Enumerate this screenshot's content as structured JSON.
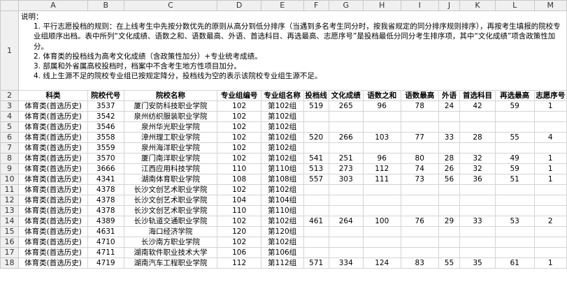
{
  "columns": [
    "A",
    "B",
    "C",
    "D",
    "E",
    "F",
    "G",
    "H",
    "I",
    "J",
    "K",
    "L",
    "M"
  ],
  "row_numbers": [
    "1",
    "2"
  ],
  "notes": {
    "title": "说明：",
    "lines": [
      "1. 平行志愿投档的规则：在上线考生中先按分数优先的原则从高分到低分排序（当遇到多名考生同分时，按我省规定的同分排序规则排序），再按考生填报的院校专业组顺序出档。表中所列“文化成绩、语数之和、语数最高、外语、首选科目、再选最高、志愿序号”是投档最低分同分考生排序项，其中“文化成绩”项含政策性加分。",
      "2. 体育类的投档线为高考文化成绩（含政策性加分）+专业统考成绩。",
      "3. 部属和外省属高校投档时，档案中不含考生地方性项目加分。",
      "4. 线上生源不足的院校专业组已按规定降分，投档线为空的表示该院校专业组生源不足。"
    ]
  },
  "table": {
    "headers": [
      "科类",
      "院校代号",
      "院校名称",
      "专业组编号",
      "专业组名称",
      "投档线",
      "文化成绩",
      "语数之和",
      "语数最高",
      "外语",
      "首选科目",
      "再选最高",
      "志愿序号"
    ],
    "rows": [
      {
        "num": "3",
        "cells": [
          "体育类(首选历史)",
          "3537",
          "厦门安防科技职业学院",
          "102",
          "第102组",
          "519",
          "265",
          "96",
          "78",
          "24",
          "42",
          "59",
          "1"
        ]
      },
      {
        "num": "4",
        "cells": [
          "体育类(首选历史)",
          "3542",
          "泉州纺织服装职业学院",
          "102",
          "第102组",
          "",
          "",
          "",
          "",
          "",
          "",
          "",
          ""
        ]
      },
      {
        "num": "5",
        "cells": [
          "体育类(首选历史)",
          "3546",
          "泉州华光职业学院",
          "102",
          "第102组",
          "",
          "",
          "",
          "",
          "",
          "",
          "",
          ""
        ]
      },
      {
        "num": "6",
        "cells": [
          "体育类(首选历史)",
          "3558",
          "漳州理工职业学院",
          "102",
          "第102组",
          "520",
          "266",
          "103",
          "77",
          "33",
          "28",
          "55",
          "4"
        ]
      },
      {
        "num": "7",
        "cells": [
          "体育类(首选历史)",
          "3559",
          "泉州海洋职业学院",
          "102",
          "第102组",
          "",
          "",
          "",
          "",
          "",
          "",
          "",
          ""
        ]
      },
      {
        "num": "8",
        "cells": [
          "体育类(首选历史)",
          "3570",
          "厦门南洋职业学院",
          "102",
          "第102组",
          "541",
          "251",
          "96",
          "80",
          "28",
          "32",
          "49",
          "1"
        ]
      },
      {
        "num": "9",
        "cells": [
          "体育类(首选历史)",
          "3666",
          "江西应用科技学院",
          "110",
          "第110组",
          "513",
          "273",
          "112",
          "74",
          "26",
          "32",
          "59",
          "1"
        ]
      },
      {
        "num": "10",
        "cells": [
          "体育类(首选历史)",
          "4341",
          "湖南体育职业学院",
          "108",
          "第108组",
          "557",
          "303",
          "111",
          "73",
          "56",
          "36",
          "51",
          "1"
        ]
      },
      {
        "num": "11",
        "cells": [
          "体育类(首选历史)",
          "4378",
          "长沙文创艺术职业学院",
          "102",
          "第102组",
          "",
          "",
          "",
          "",
          "",
          "",
          "",
          ""
        ]
      },
      {
        "num": "12",
        "cells": [
          "体育类(首选历史)",
          "4378",
          "长沙文创艺术职业学院",
          "104",
          "第104组",
          "",
          "",
          "",
          "",
          "",
          "",
          "",
          ""
        ]
      },
      {
        "num": "13",
        "cells": [
          "体育类(首选历史)",
          "4378",
          "长沙文创艺术职业学院",
          "110",
          "第110组",
          "",
          "",
          "",
          "",
          "",
          "",
          "",
          ""
        ]
      },
      {
        "num": "14",
        "cells": [
          "体育类(首选历史)",
          "4389",
          "长沙轨道交通职业学院",
          "102",
          "第102组",
          "461",
          "264",
          "100",
          "76",
          "29",
          "33",
          "53",
          "2"
        ]
      },
      {
        "num": "15",
        "cells": [
          "体育类(首选历史)",
          "4631",
          "海口经济学院",
          "120",
          "第120组",
          "",
          "",
          "",
          "",
          "",
          "",
          "",
          ""
        ]
      },
      {
        "num": "16",
        "cells": [
          "体育类(首选历史)",
          "4710",
          "长沙南方职业学院",
          "102",
          "第102组",
          "",
          "",
          "",
          "",
          "",
          "",
          "",
          ""
        ]
      },
      {
        "num": "17",
        "cells": [
          "体育类(首选历史)",
          "4711",
          "湖南软件职业技术大学",
          "106",
          "第106组",
          "",
          "",
          "",
          "",
          "",
          "",
          "",
          ""
        ]
      },
      {
        "num": "18",
        "cells": [
          "体育类(首选历史)",
          "4719",
          "湖南汽车工程职业学院",
          "112",
          "第112组",
          "571",
          "334",
          "124",
          "83",
          "55",
          "35",
          "61",
          "1"
        ]
      }
    ]
  }
}
